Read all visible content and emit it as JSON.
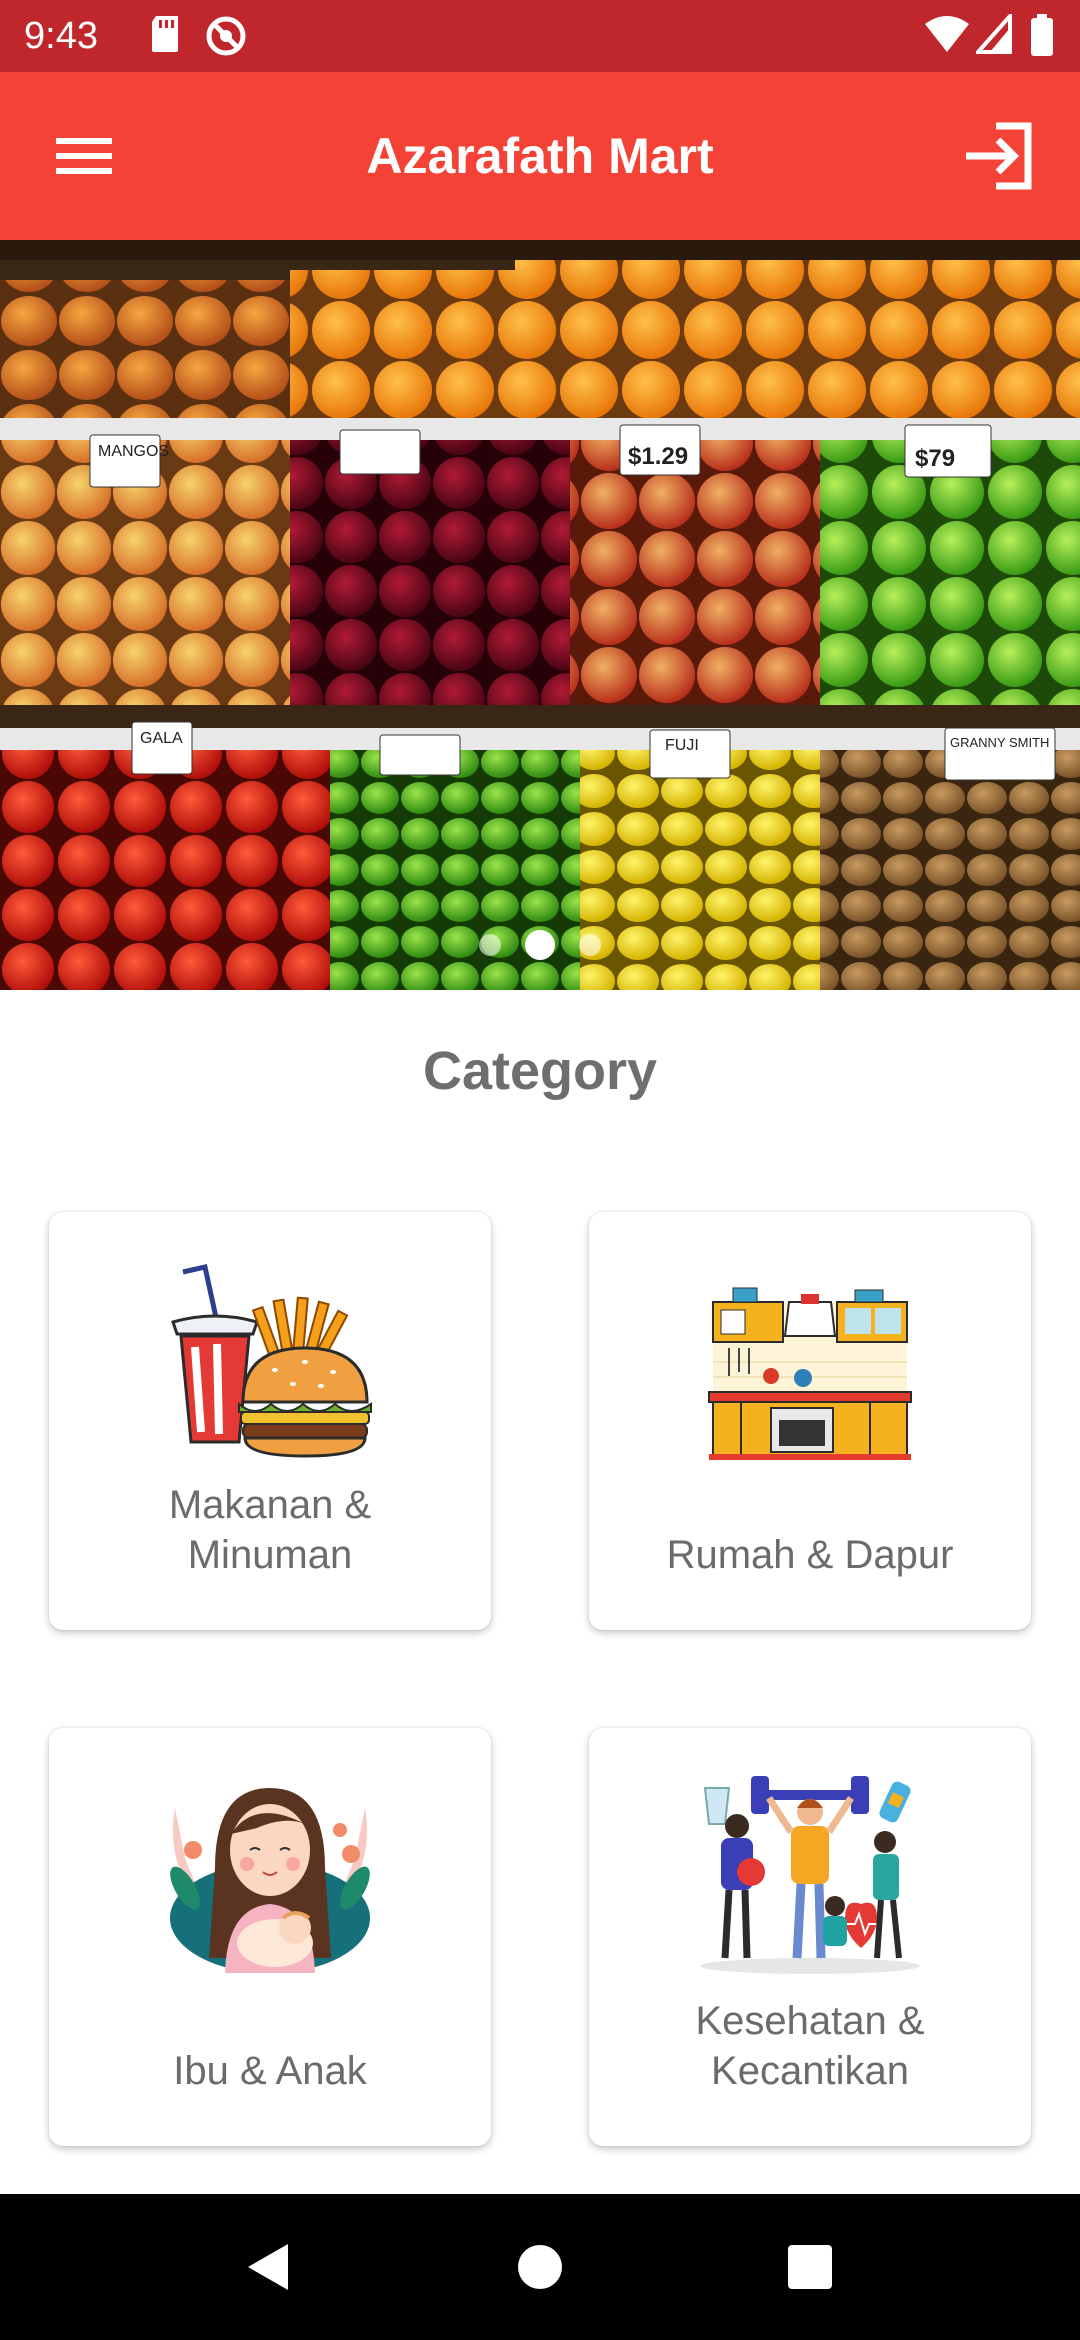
{
  "status_bar": {
    "time": "9:43",
    "icons": [
      "sd-card-icon",
      "no-disturb-icon",
      "wifi-icon",
      "signal-icon",
      "battery-icon"
    ]
  },
  "app_bar": {
    "title": "Azarafath Mart",
    "menu_icon": "hamburger-menu-icon",
    "action_icon": "login-icon"
  },
  "banner": {
    "description": "banner-image",
    "slide_count": 3,
    "active_slide": 2,
    "price_tags": [
      "MANGOS",
      "$1.29",
      "$79",
      "GALA",
      "FUJI",
      "GRANNY SMITH"
    ]
  },
  "categories": {
    "title": "Category",
    "items": [
      {
        "label": "Makanan &\nMinuman",
        "icon": "food-drink-icon"
      },
      {
        "label": "Rumah & Dapur",
        "icon": "kitchen-icon"
      },
      {
        "label": "Ibu & Anak",
        "icon": "mother-child-icon"
      },
      {
        "label": "Kesehatan &\nKecantikan",
        "icon": "health-beauty-icon"
      }
    ]
  },
  "nav_bar": {
    "icons": [
      "back-icon",
      "home-icon",
      "recents-icon"
    ]
  },
  "colors": {
    "app_bar": "#f44336",
    "status_bar": "#c0272d",
    "title_text": "#6e6e6e",
    "card_text": "#6b6b6b"
  }
}
